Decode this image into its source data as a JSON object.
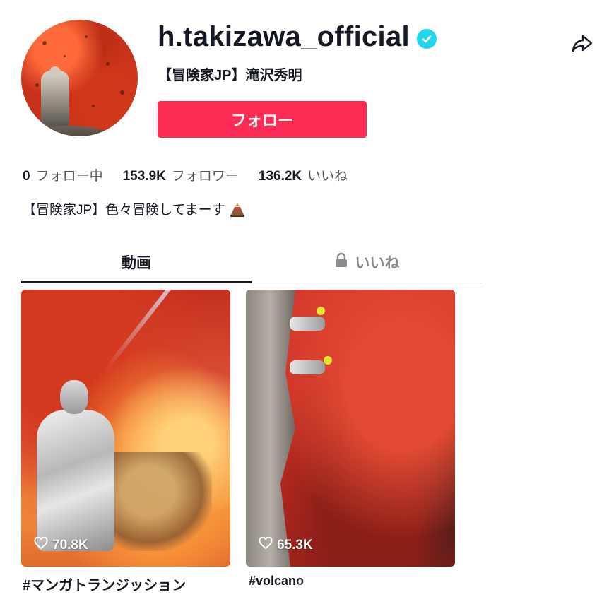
{
  "profile": {
    "username": "h.takizawa_official",
    "nickname": "【冒険家JP】滝沢秀明",
    "verified": true,
    "follow_button": "フォロー",
    "bio": "【冒険家JP】色々冒険してまーす",
    "bio_emoji": "volcano-icon"
  },
  "stats": [
    {
      "number": "0",
      "label": "フォロー中"
    },
    {
      "number": "153.9K",
      "label": "フォロワー"
    },
    {
      "number": "136.2K",
      "label": "いいね"
    }
  ],
  "tabs": {
    "videos": "動画",
    "liked": "いいね",
    "active": "videos"
  },
  "videos": [
    {
      "likes": "70.8K",
      "caption": "#マンガトランジッション"
    },
    {
      "likes": "65.3K",
      "caption": "#volcano"
    }
  ],
  "colors": {
    "follow_button": "#fe2c55",
    "verified_badge": "#20d5ec",
    "text_primary": "#161823"
  }
}
